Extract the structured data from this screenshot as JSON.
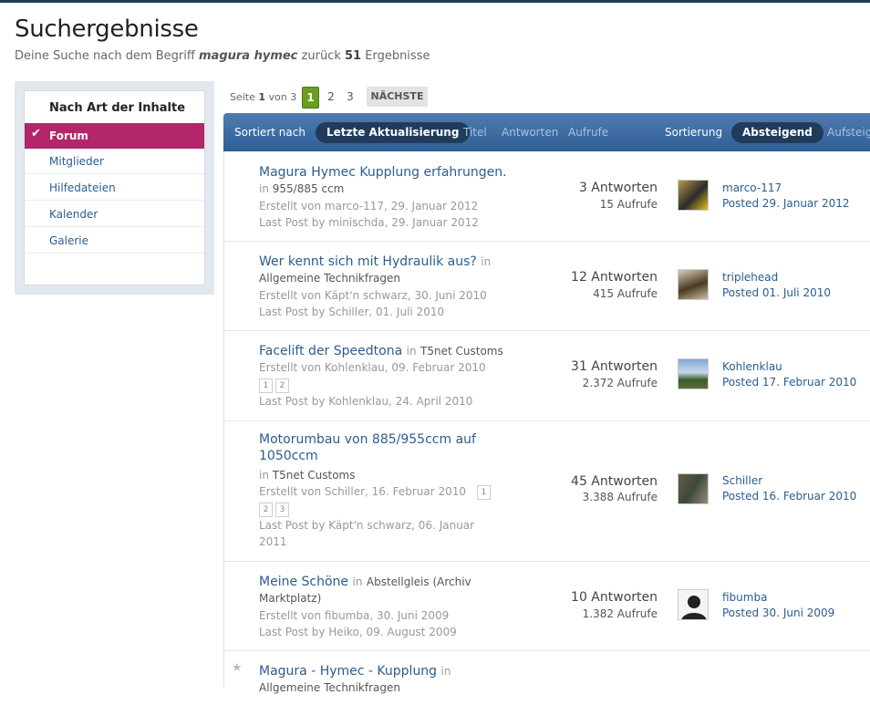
{
  "page": {
    "title": "Suchergebnisse",
    "subtitle_prefix": "Deine Suche nach dem Begriff",
    "query": "magura hymec",
    "subtitle_mid": "zurück",
    "count": "51",
    "subtitle_suffix": "Ergebnisse"
  },
  "sidebar": {
    "heading": "Nach Art der Inhalte",
    "items": [
      {
        "label": "Forum",
        "active": true
      },
      {
        "label": "Mitglieder"
      },
      {
        "label": "Hilfedateien"
      },
      {
        "label": "Kalender"
      },
      {
        "label": "Galerie"
      }
    ]
  },
  "pagination": {
    "label_prefix": "Seite",
    "current": "1",
    "label_mid": "von",
    "total": "3",
    "pages": [
      "1",
      "2",
      "3"
    ],
    "next": "NÄCHSTE"
  },
  "sortbar": {
    "sort_by_label": "Sortiert nach",
    "options": [
      "Letzte Aktualisierung",
      "Titel",
      "Antworten",
      "Aufrufe"
    ],
    "order_label": "Sortierung",
    "orders": [
      "Absteigend",
      "Aufsteigend"
    ]
  },
  "results": [
    {
      "title": "Magura Hymec Kupplung erfahrungen.",
      "in": "in",
      "forum": "955/885 ccm",
      "created": "Erstellt von marco-117, 29. Januar 2012",
      "last_post": "Last Post by minischda, 29. Januar 2012",
      "replies": "3 Antworten",
      "views": "15 Aufrufe",
      "poster": "marco-117",
      "posted": "Posted 29. Januar 2012"
    },
    {
      "title": "Wer kennt sich mit Hydraulik aus?",
      "in": "in",
      "forum": "Allgemeine Technikfragen",
      "created": "Erstellt von Käpt'n schwarz, 30. Juni 2010",
      "last_post": "Last Post by Schiller, 01. Juli 2010",
      "replies": "12 Antworten",
      "views": "415 Aufrufe",
      "poster": "triplehead",
      "posted": "Posted 01. Juli 2010"
    },
    {
      "title": "Facelift der Speedtona",
      "in": "in",
      "forum": "T5net Customs",
      "created": "Erstellt von Kohlenklau, 09. Februar 2010",
      "pages": [
        "1",
        "2"
      ],
      "last_post": "Last Post by Kohlenklau, 24. April 2010",
      "replies": "31 Antworten",
      "views": "2.372 Aufrufe",
      "poster": "Kohlenklau",
      "posted": "Posted 17. Februar 2010"
    },
    {
      "title_line1": "Motorumbau von 885/955ccm auf",
      "title_line2": "1050ccm",
      "in": "in",
      "forum": "T5net Customs",
      "created": "Erstellt von Schiller, 16. Februar 2010",
      "pages": [
        "1",
        "2",
        "3"
      ],
      "last_post_line1": "Last Post by Käpt'n schwarz, 06. Januar",
      "last_post_line2": "2011",
      "replies": "45 Antworten",
      "views": "3.388 Aufrufe",
      "poster": "Schiller",
      "posted": "Posted 16. Februar 2010"
    },
    {
      "title": "Meine Schöne",
      "in": "in",
      "forum_line1": "Abstellgleis (Archiv",
      "forum_line2": "Marktplatz)",
      "created": "Erstellt von fibumba, 30. Juni 2009",
      "last_post": "Last Post by Heiko, 09. August 2009",
      "replies": "10 Antworten",
      "views": "1.382 Aufrufe",
      "poster": "fibumba",
      "posted": "Posted 30. Juni 2009"
    },
    {
      "title": "Magura - Hymec - Kupplung",
      "in": "in",
      "forum": "Allgemeine Technikfragen"
    }
  ]
}
